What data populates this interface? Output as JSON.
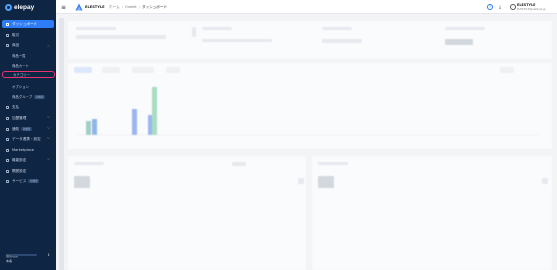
{
  "brand": {
    "name": "elepay"
  },
  "sidebar": {
    "items": [
      {
        "label": "ダッシュボード",
        "icon": "dashboard-icon",
        "active": true
      },
      {
        "label": "取引",
        "icon": "transactions-icon"
      },
      {
        "label": "商品",
        "icon": "product-icon",
        "expanded": true
      }
    ],
    "product_sub": [
      "商品一覧",
      "商品カート",
      "カテゴリー",
      "オプション",
      "商品グループ"
    ],
    "product_group_badge": "新機能",
    "items2": [
      {
        "label": "支払",
        "icon": "payment-icon"
      },
      {
        "label": "加盟管理",
        "icon": "merchant-icon"
      },
      {
        "label": "通知",
        "icon": "notification-icon",
        "badge": "新機能"
      },
      {
        "label": "データ連携・設定",
        "icon": "integration-icon"
      },
      {
        "label": "Marketplace",
        "icon": "marketplace-icon"
      },
      {
        "label": "機能設定",
        "icon": "settings-icon"
      },
      {
        "label": "開発設定",
        "icon": "developer-icon"
      },
      {
        "label": "サービス",
        "icon": "service-icon",
        "badge": "新機能"
      }
    ],
    "footer_label": "環境切替",
    "footer_mode": "本番"
  },
  "header": {
    "shop_name": "ELESTYLE",
    "breadcrumbs": [
      "ホーム",
      "Onekit",
      "ダッシュボード"
    ],
    "user_name": "ELESTYLE",
    "user_email": "ELESTYLE@elestyle.jp"
  }
}
